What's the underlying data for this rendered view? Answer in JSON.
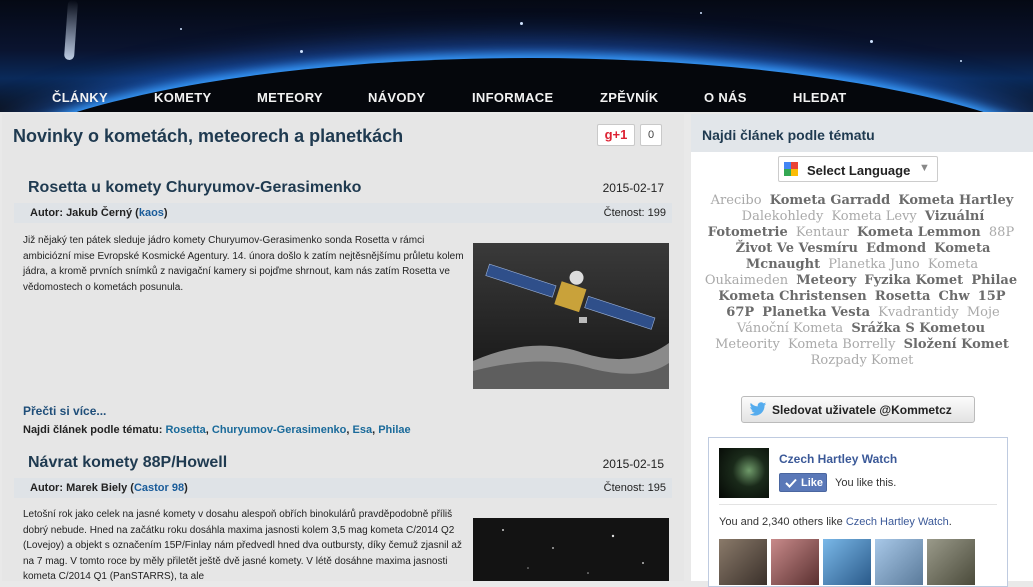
{
  "nav": {
    "items": [
      "ČLÁNKY",
      "KOMETY",
      "METEORY",
      "NÁVODY",
      "INFORMACE",
      "ZPĚVNÍK",
      "O NÁS",
      "HLEDAT"
    ]
  },
  "main": {
    "title": "Novinky o kometách, meteorech a planetkách",
    "gplus_label": "g+1",
    "gplus_count": "0",
    "read_more_label": "Přečti si více...",
    "topics_label": "Najdi článek podle tématu:",
    "articles": [
      {
        "title": "Rosetta u komety Churyumov-Gerasimenko",
        "date": "2015-02-17",
        "author_label": "Autor:",
        "author": "Jakub Černý",
        "nick": "kaos",
        "reads": "Čtenost: 199",
        "text": "Již nějaký ten pátek sleduje jádro komety Churyumov-Gerasimenko sonda Rosetta v rámci ambiciózní mise Evropské Kosmické Agentury. 14. února došlo k zatím nejtěsnějšímu průletu kolem jádra, a kromě prvních snímků z navigační kamery si pojďme shrnout, kam nás zatím Rosetta ve vědomostech o kometách posunula.",
        "tags": [
          "Rosetta",
          "Churyumov-Gerasimenko",
          "Esa",
          "Philae"
        ]
      },
      {
        "title": "Návrat komety 88P/Howell",
        "date": "2015-02-15",
        "author_label": "Autor:",
        "author": "Marek Biely",
        "nick": "Castor 98",
        "reads": "Čtenost: 195",
        "text": "Letošní rok jako celek na jasné komety v dosahu alespoň obřích binokulárů pravděpodobně příliš dobrý nebude. Hned na začátku roku dosáhla maxima jasnosti kolem 3,5 mag kometa C/2014 Q2 (Lovejoy) a objekt s označením 15P/Finlay nám předvedl hned dva outbursty, díky čemuž zjasnil až na 7 mag. V tomto roce by měly přiletět ještě dvě jasné komety. V létě dosáhne maxima jasnosti kometa C/2014 Q1 (PanSTARRS), ta ale"
      }
    ]
  },
  "sidebar": {
    "title": "Najdi článek podle tématu",
    "language_label": "Select Language",
    "tags": [
      {
        "label": "Arecibo",
        "weight": "light"
      },
      {
        "label": "Kometa Garradd",
        "weight": "dark"
      },
      {
        "label": "Kometa Hartley",
        "weight": "dark"
      },
      {
        "label": "Dalekohledy",
        "weight": "light"
      },
      {
        "label": "Kometa Levy",
        "weight": "light"
      },
      {
        "label": "Vizuální Fotometrie",
        "weight": "dark"
      },
      {
        "label": "Kentaur",
        "weight": "light"
      },
      {
        "label": "Kometa Lemmon",
        "weight": "dark"
      },
      {
        "label": "88P",
        "weight": "light"
      },
      {
        "label": "Život Ve Vesmíru",
        "weight": "dark"
      },
      {
        "label": "Edmond",
        "weight": "dark"
      },
      {
        "label": "Kometa Mcnaught",
        "weight": "dark"
      },
      {
        "label": "Planetka Juno",
        "weight": "light"
      },
      {
        "label": "Kometa Oukaimeden",
        "weight": "light"
      },
      {
        "label": "Meteory",
        "weight": "dark"
      },
      {
        "label": "Fyzika Komet",
        "weight": "dark"
      },
      {
        "label": "Philae",
        "weight": "dark"
      },
      {
        "label": "Kometa Christensen",
        "weight": "dark"
      },
      {
        "label": "Rosetta",
        "weight": "dark"
      },
      {
        "label": "Chw",
        "weight": "dark"
      },
      {
        "label": "15P",
        "weight": "dark"
      },
      {
        "label": "67P",
        "weight": "dark"
      },
      {
        "label": "Planetka Vesta",
        "weight": "dark"
      },
      {
        "label": "Kvadrantidy",
        "weight": "light"
      },
      {
        "label": "Moje Vánoční Kometa",
        "weight": "light"
      },
      {
        "label": "Srážka S Kometou",
        "weight": "dark"
      },
      {
        "label": "Meteority",
        "weight": "light"
      },
      {
        "label": "Kometa Borrelly",
        "weight": "light"
      },
      {
        "label": "Složení Komet",
        "weight": "dark"
      },
      {
        "label": "Rozpady Komet",
        "weight": "light"
      }
    ],
    "twitter_label": "Sledovat uživatele @Kommetcz",
    "facebook": {
      "page_name": "Czech Hartley Watch",
      "like_label": "Like",
      "you_like": "You like this.",
      "others_prefix": "You and 2,340 others like ",
      "others_page": "Czech Hartley Watch",
      "others_suffix": "."
    }
  },
  "colors": {
    "title": "#1f3a50",
    "link": "#1a6a9a",
    "facebook": "#3b5998"
  }
}
